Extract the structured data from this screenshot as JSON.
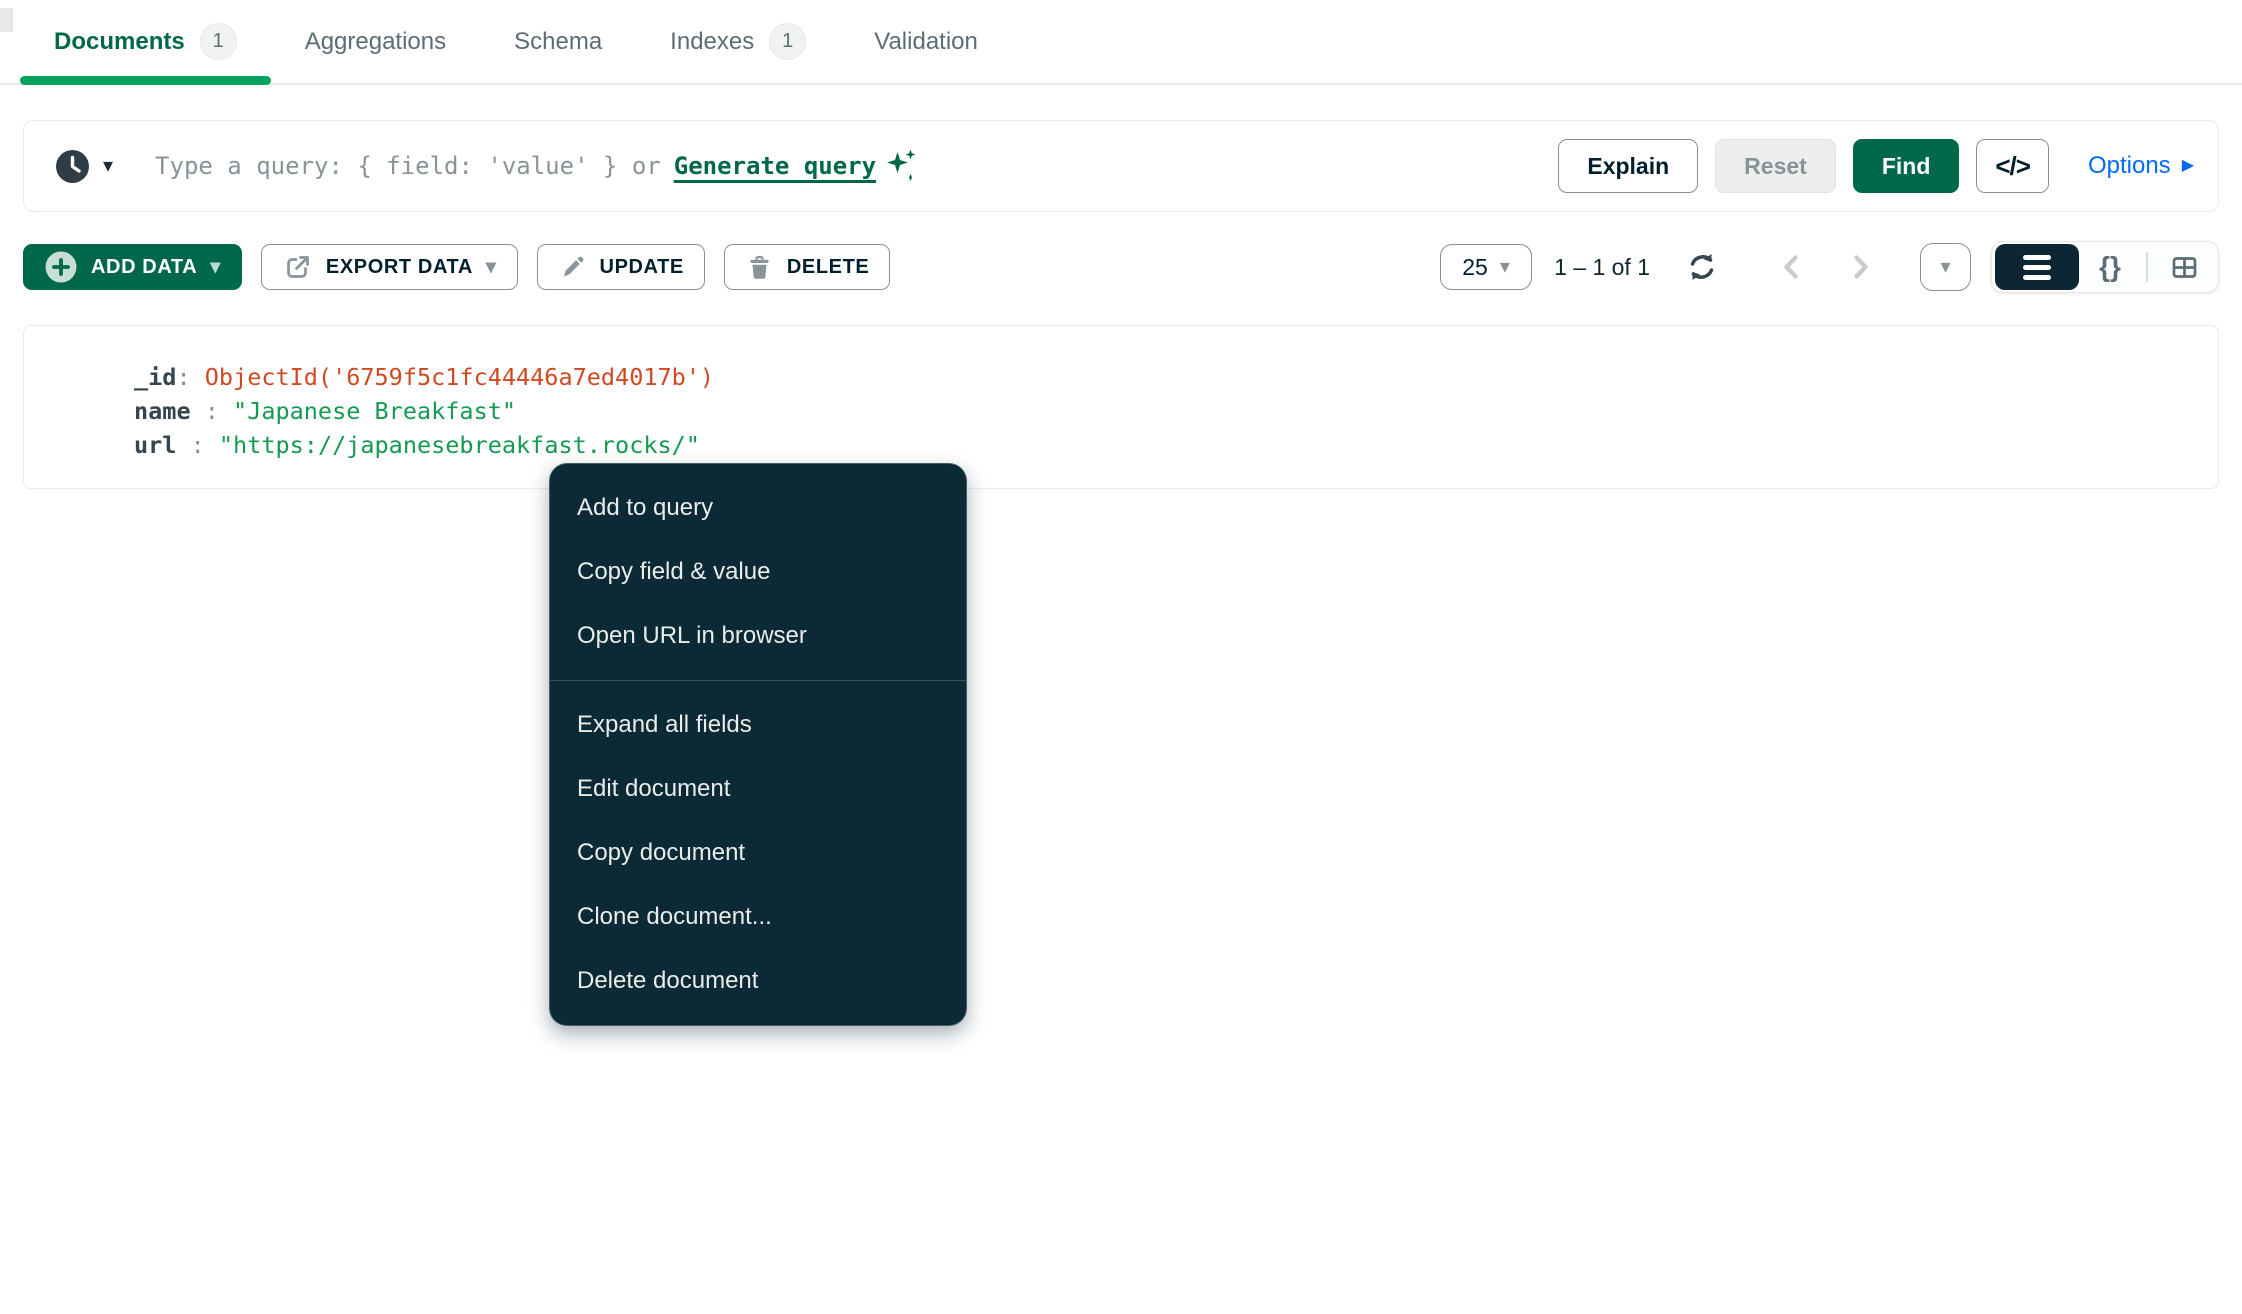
{
  "tabs": [
    {
      "label": "Documents",
      "badge": "1"
    },
    {
      "label": "Aggregations"
    },
    {
      "label": "Schema"
    },
    {
      "label": "Indexes",
      "badge": "1"
    },
    {
      "label": "Validation"
    }
  ],
  "query_bar": {
    "placeholder": "Type a query: { field: 'value' } or",
    "generate_query_label": "Generate query",
    "history_caret": "▾",
    "explain_label": "Explain",
    "reset_label": "Reset",
    "find_label": "Find",
    "code_toggle_glyph": "</>",
    "options_label": "Options",
    "options_arrow": "▶"
  },
  "toolbar": {
    "add_data_label": "ADD DATA",
    "add_data_caret": "▾",
    "export_data_label": "EXPORT DATA",
    "export_data_caret": "▾",
    "update_label": "UPDATE",
    "delete_label": "DELETE",
    "page_size_value": "25",
    "page_size_caret": "▾",
    "pagination_text": "1 – 1 of 1",
    "overflow_caret": "▾",
    "json_view_glyph": "{}"
  },
  "document": {
    "fields": [
      {
        "key": "_id",
        "sep": ": ",
        "value": "ObjectId('6759f5c1fc44446a7ed4017b')",
        "type": "objectid"
      },
      {
        "key": "name",
        "sep": " : ",
        "value": "\"Japanese Breakfast\"",
        "type": "string"
      },
      {
        "key": "url",
        "sep": " : ",
        "value": "\"https://japanesebreakfast.rocks/\"",
        "type": "string"
      }
    ]
  },
  "context_menu": {
    "groups": [
      {
        "items": [
          "Add to query",
          "Copy field & value",
          "Open URL in browser"
        ]
      },
      {
        "items": [
          "Expand all fields",
          "Edit document",
          "Copy document",
          "Clone document...",
          "Delete document"
        ]
      }
    ]
  },
  "colors": {
    "accent_green_dark": "#00684A",
    "accent_green": "#00A35C",
    "string_green": "#139A53",
    "objectid_red": "#CF4A22",
    "link_blue": "#016BF8",
    "menu_bg": "#0C2936",
    "text_dark": "#001E2B",
    "text_gray": "#5C6C75",
    "border_light": "#E8EDEB"
  }
}
